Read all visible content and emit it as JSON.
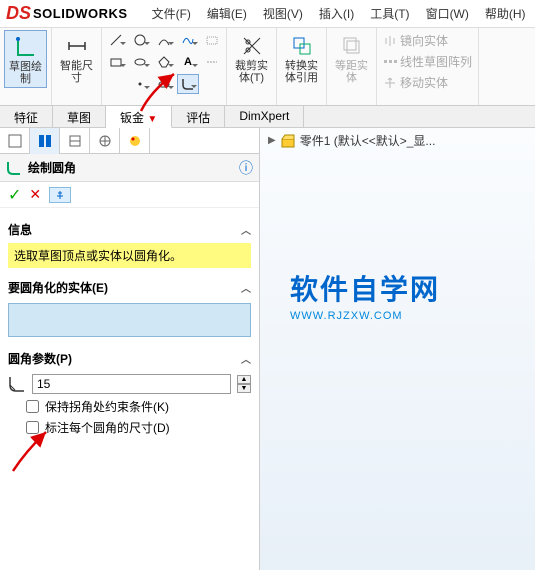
{
  "app": {
    "brand": "SOLIDWORKS"
  },
  "menu": {
    "file": "文件(F)",
    "edit": "编辑(E)",
    "view": "视图(V)",
    "insert": "插入(I)",
    "tools": "工具(T)",
    "window": "窗口(W)",
    "help": "帮助(H)"
  },
  "ribbon": {
    "sketch": "草图绘\n制",
    "smartdim": "智能尺\n寸",
    "trim": "裁剪实\n体(T)",
    "convert": "转换实\n体引用",
    "offset": "等距实\n体",
    "mirror": "镜向实体",
    "pattern": "线性草图阵列",
    "move": "移动实体"
  },
  "tabs": [
    "特征",
    "草图",
    "钣金",
    "评估",
    "DimXpert"
  ],
  "active_tab": "钣金",
  "tree": {
    "part": "零件1  (默认<<默认>_显..."
  },
  "prop": {
    "title": "绘制圆角",
    "info_label": "信息",
    "info_text": "选取草图顶点或实体以圆角化。",
    "entities_label": "要圆角化的实体(E)",
    "params_label": "圆角参数(P)",
    "radius": "15",
    "keep_constraint": "保持拐角处约束条件(K)",
    "dim_each": "标注每个圆角的尺寸(D)"
  },
  "watermark": {
    "main": "软件自学网",
    "sub": "WWW.RJZXW.COM"
  }
}
